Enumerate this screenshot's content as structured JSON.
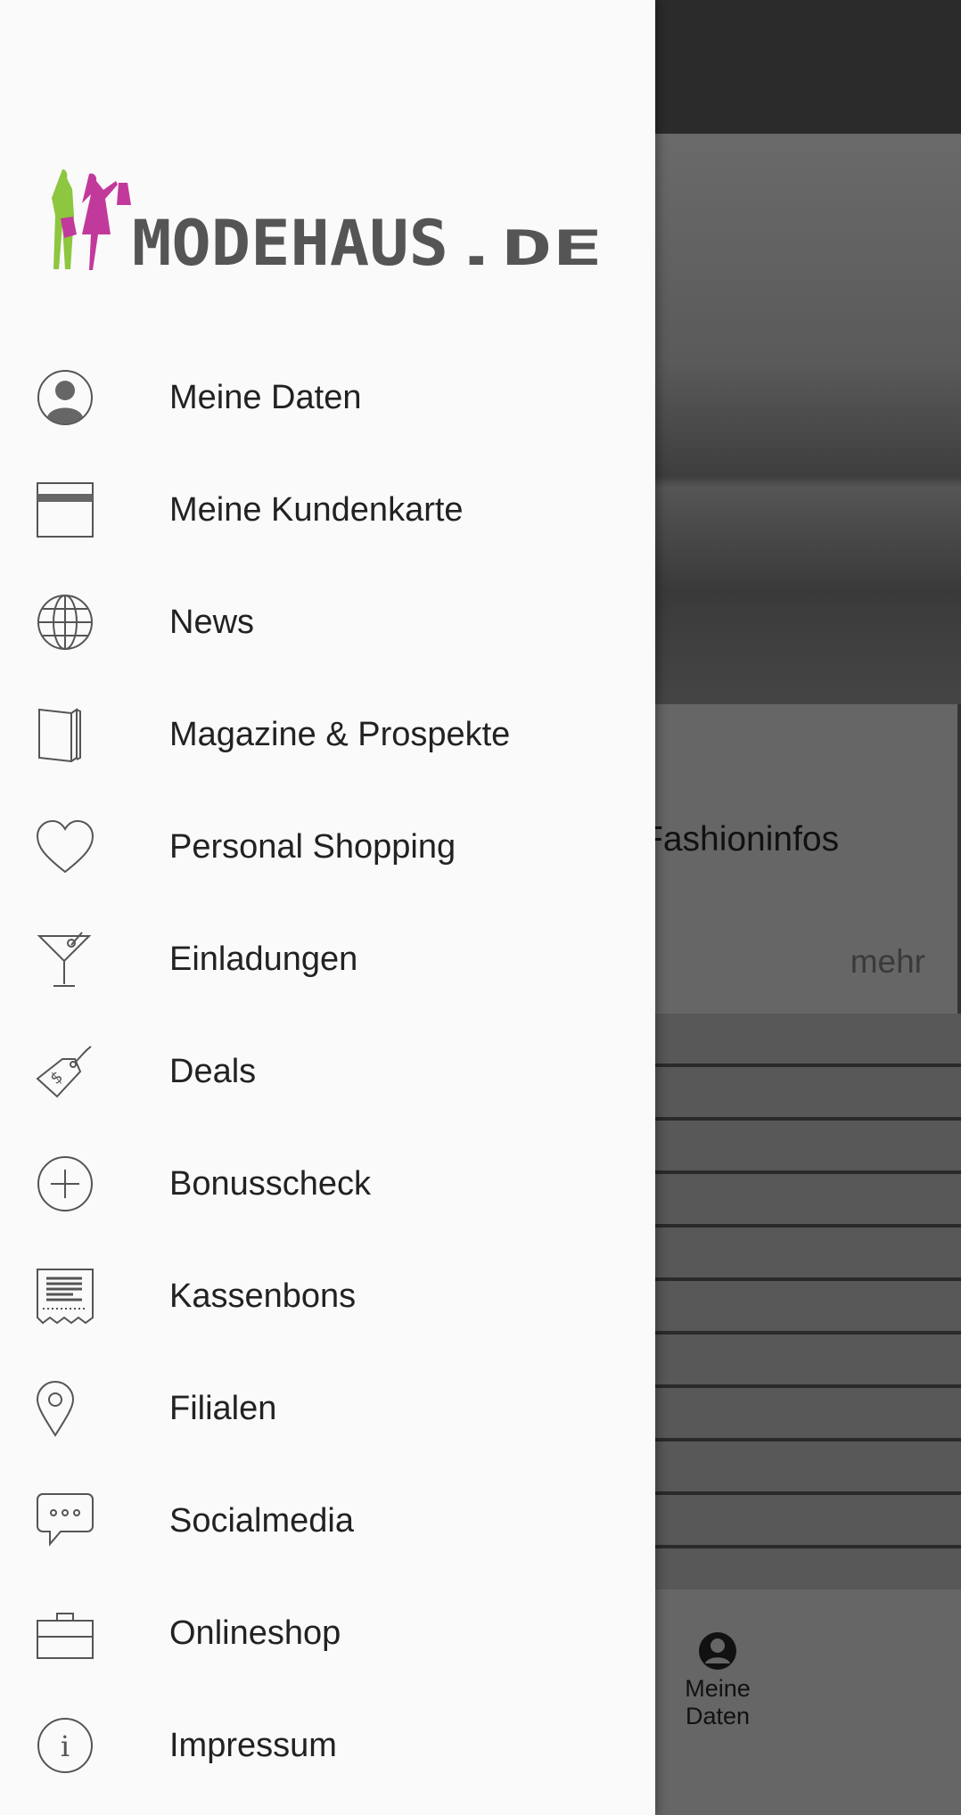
{
  "background": {
    "card": {
      "title": "Fashioninfos",
      "more_label": "mehr"
    },
    "bottom_nav": {
      "items": [
        {
          "label": "Meine Daten",
          "icon": "user-icon"
        }
      ]
    }
  },
  "drawer": {
    "logo_text": "MODEHAUS.DE",
    "items": [
      {
        "label": "Meine Daten",
        "icon": "user-icon"
      },
      {
        "label": "Meine Kundenkarte",
        "icon": "card-icon"
      },
      {
        "label": "News",
        "icon": "globe-icon"
      },
      {
        "label": "Magazine & Prospekte",
        "icon": "magazine-icon"
      },
      {
        "label": "Personal Shopping",
        "icon": "heart-icon"
      },
      {
        "label": "Einladungen",
        "icon": "cocktail-icon"
      },
      {
        "label": "Deals",
        "icon": "price-tag-icon"
      },
      {
        "label": "Bonusscheck",
        "icon": "plus-circle-icon"
      },
      {
        "label": "Kassenbons",
        "icon": "receipt-icon"
      },
      {
        "label": "Filialen",
        "icon": "location-pin-icon"
      },
      {
        "label": "Socialmedia",
        "icon": "chat-bubble-icon"
      },
      {
        "label": "Onlineshop",
        "icon": "shopping-bag-icon"
      },
      {
        "label": "Impressum",
        "icon": "info-icon"
      }
    ]
  },
  "colors": {
    "logo_green": "#8dc63f",
    "logo_magenta": "#c2399c",
    "logo_gray": "#555555",
    "drawer_bg": "#fafafa"
  }
}
